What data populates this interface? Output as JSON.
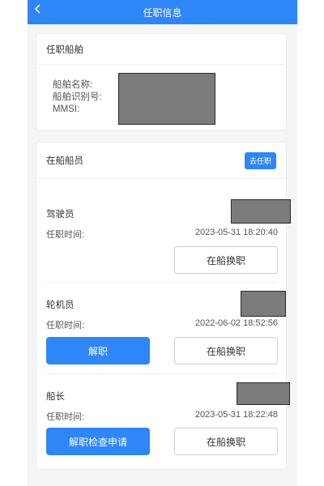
{
  "navbar": {
    "title": "任职信息",
    "back_icon": "chevron-left-icon"
  },
  "ship_card": {
    "title": "任职船舶",
    "labels": {
      "name": "船舶名称:",
      "id": "船舶识别号:",
      "mmsi": "MMSI:"
    }
  },
  "crew_card": {
    "title": "在船船员",
    "go_button": "去任职",
    "members": [
      {
        "role": "驾驶员",
        "time_label": "任职时间:",
        "time": "2023-05-31 18:20:40",
        "switch_button": "在船换职"
      },
      {
        "role": "轮机员",
        "time_label": "任职时间:",
        "time": "2022-06-02 18:52:56",
        "primary_button": "解职",
        "switch_button": "在船换职"
      },
      {
        "role": "船长",
        "time_label": "任职时间:",
        "time": "2023-05-31 18:22:48",
        "primary_button": "解职检查申请",
        "switch_button": "在船换职"
      }
    ]
  },
  "home_fab": {
    "icon": "home-icon"
  },
  "colors": {
    "primary": "#2f86f6",
    "background": "#f4f5f7",
    "redaction": "#7b7b7b"
  }
}
